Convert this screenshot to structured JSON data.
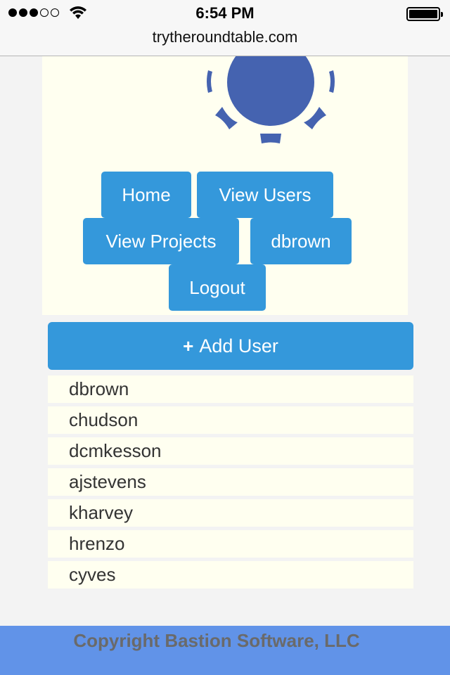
{
  "status_bar": {
    "time": "6:54 PM",
    "url": "trytheroundtable.com",
    "signal_icon": "signal-bars-icon",
    "wifi_icon": "wifi-icon",
    "battery_icon": "battery-icon"
  },
  "logo": {
    "icon": "sun-logo-icon",
    "color": "#4563b0"
  },
  "nav": {
    "home": "Home",
    "view_users": "View Users",
    "view_projects": "View Projects",
    "username": "dbrown",
    "logout": "Logout"
  },
  "add_user": {
    "icon": "plus-icon",
    "plus": "+",
    "label": "Add User"
  },
  "users": [
    "dbrown",
    "chudson",
    "dcmkesson",
    "ajstevens",
    "kharvey",
    "hrenzo",
    "cyves"
  ],
  "footer": {
    "copyright": "Copyright Bastion Software, LLC"
  },
  "colors": {
    "accent": "#3498db",
    "panel": "#fffff0",
    "footer": "#6193e8",
    "page": "#f3f3f3"
  }
}
